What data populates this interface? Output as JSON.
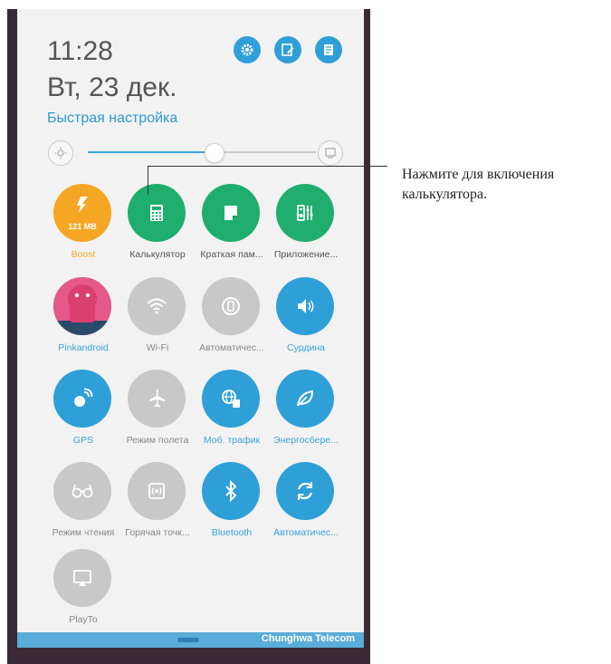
{
  "header": {
    "time": "11:28",
    "date": "Вт, 23 дек.",
    "quick_settings": "Быстрая настройка",
    "buttons": [
      "settings-icon",
      "edit-icon",
      "notes-icon"
    ]
  },
  "brightness": {
    "level": 0.55
  },
  "tiles": [
    {
      "label": "Boost",
      "sub": "121 MB",
      "color": "#f5a623",
      "label_color": "#f5a623"
    },
    {
      "label": "Калькулятор",
      "color": "#1fae6d",
      "label_color": "#555"
    },
    {
      "label": "Краткая пам...",
      "color": "#1fae6d",
      "label_color": "#555"
    },
    {
      "label": "Приложение...",
      "color": "#1fae6d",
      "label_color": "#555"
    },
    {
      "label": "Pinkandroid",
      "color": "#e4588a",
      "label_color": "#3aa3dc"
    },
    {
      "label": "Wi-Fi",
      "color": "#c8c8c8",
      "label_color": "#888"
    },
    {
      "label": "Автоматичес...",
      "color": "#c8c8c8",
      "label_color": "#888"
    },
    {
      "label": "Сурдина",
      "color": "#2f9fd8",
      "label_color": "#3aa3dc"
    },
    {
      "label": "GPS",
      "color": "#2f9fd8",
      "label_color": "#3aa3dc"
    },
    {
      "label": "Режим полета",
      "color": "#c8c8c8",
      "label_color": "#888"
    },
    {
      "label": "Моб. трафик",
      "color": "#2f9fd8",
      "label_color": "#3aa3dc"
    },
    {
      "label": "Энергосбере...",
      "color": "#2f9fd8",
      "label_color": "#3aa3dc"
    },
    {
      "label": "Режим чтения",
      "color": "#c8c8c8",
      "label_color": "#888"
    },
    {
      "label": "Горячая точк...",
      "color": "#c8c8c8",
      "label_color": "#888"
    },
    {
      "label": "Bluetooth",
      "color": "#2f9fd8",
      "label_color": "#3aa3dc"
    },
    {
      "label": "Автоматичес...",
      "color": "#2f9fd8",
      "label_color": "#3aa3dc"
    },
    {
      "label": "PlayTo",
      "color": "#c8c8c8",
      "label_color": "#888"
    }
  ],
  "status_bar": {
    "carrier": "Chunghwa Telecom"
  },
  "callout": {
    "line1": "Нажмите для включения",
    "line2": "калькулятора."
  }
}
